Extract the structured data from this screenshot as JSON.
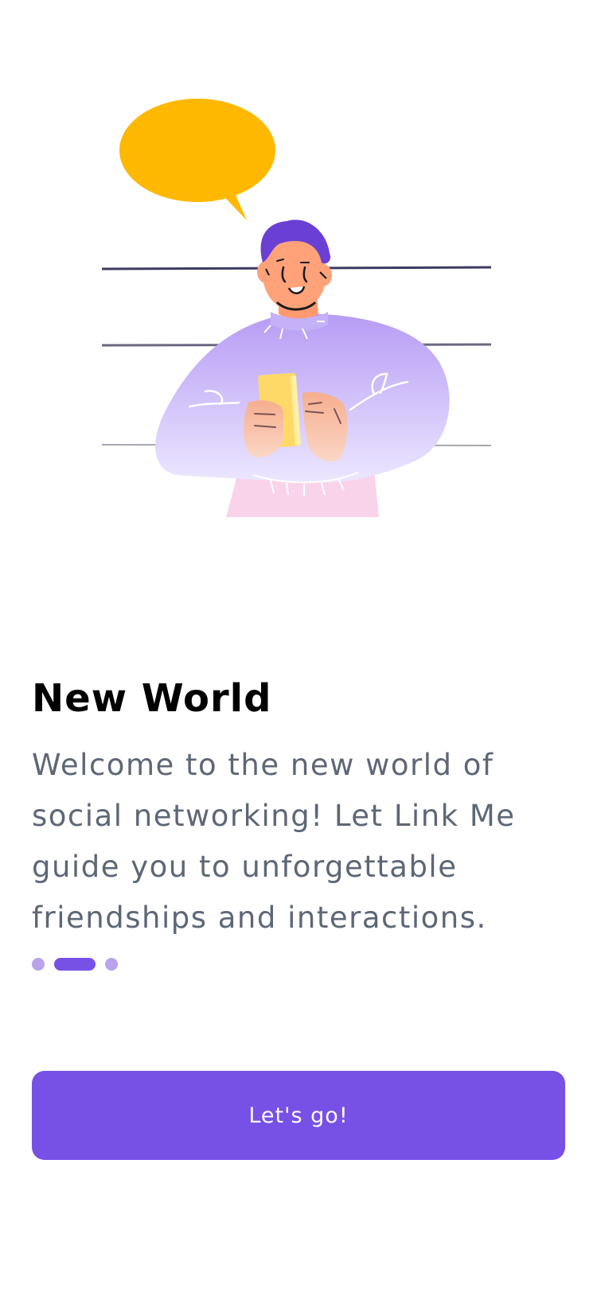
{
  "onboarding": {
    "title": "New World",
    "description": "Welcome to the new world of social networking! Let Link Me guide you to unforgettable friendships and interactions.",
    "pagination": {
      "total": 3,
      "active_index": 1
    },
    "button_label": "Let's go!"
  },
  "colors": {
    "accent": "#7750e6",
    "dot_inactive": "#b8a3ec",
    "speech_bubble": "#ffb800",
    "body_text": "#5d6776",
    "sweater": "#c4b0f8",
    "hair": "#6a3fd4",
    "skin": "#ffa27a",
    "phone": "#ffd968",
    "pants": "#f9d3ea"
  },
  "icons": {
    "illustration": "person-with-phone-illustration",
    "speech_bubble": "speech-bubble-icon"
  }
}
